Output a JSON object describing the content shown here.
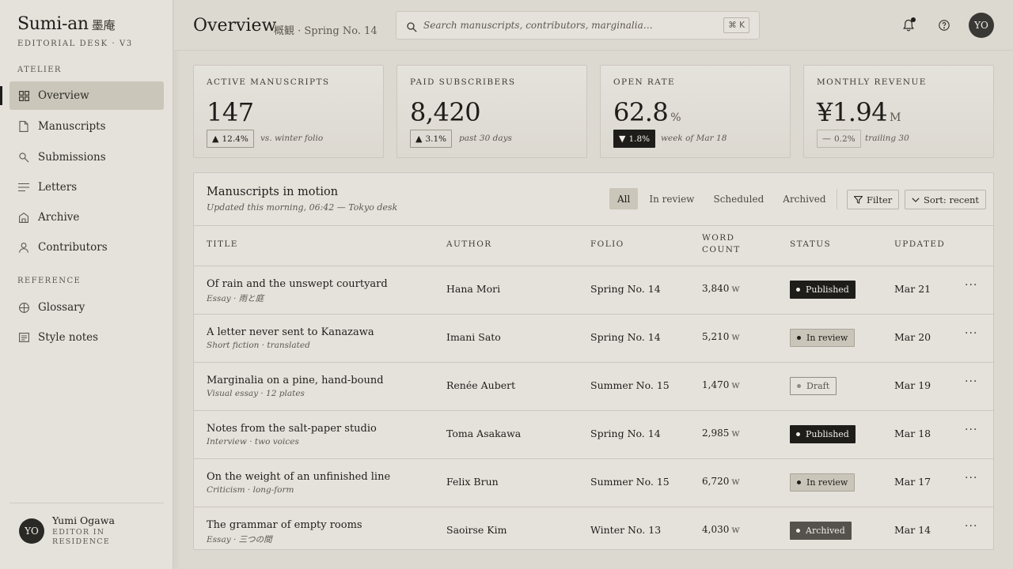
{
  "brand": {
    "name": "Sumi-an",
    "kanji": "墨庵",
    "subtitle": "EDITORIAL DESK · V3"
  },
  "sidebar": {
    "section_atelier": "ATELIER",
    "section_reference": "REFERENCE",
    "items": [
      {
        "label": "Overview",
        "icon": "grid-icon",
        "active": true
      },
      {
        "label": "Manuscripts",
        "icon": "document-icon"
      },
      {
        "label": "Submissions",
        "icon": "magnifier-icon"
      },
      {
        "label": "Letters",
        "icon": "lines-icon"
      },
      {
        "label": "Archive",
        "icon": "archive-icon"
      },
      {
        "label": "Contributors",
        "icon": "person-icon"
      }
    ],
    "reference_items": [
      {
        "label": "Glossary",
        "icon": "globe-icon"
      },
      {
        "label": "Style notes",
        "icon": "notes-icon"
      }
    ],
    "user": {
      "initials": "YO",
      "name": "Yumi Ogawa",
      "role_line1": "EDITOR IN",
      "role_line2": "RESIDENCE"
    }
  },
  "header": {
    "title": "Overview",
    "subtitle": "概観 · Spring No. 14",
    "search_placeholder": "Search manuscripts, contributors, marginalia…",
    "shortcut": "⌘ K",
    "avatar_initials": "YO"
  },
  "stats": [
    {
      "label": "ACTIVE MANUSCRIPTS",
      "value": "147",
      "unit": "",
      "delta": "12.4%",
      "direction": "up",
      "note": "vs. winter folio"
    },
    {
      "label": "PAID SUBSCRIBERS",
      "value": "8,420",
      "unit": "",
      "delta": "3.1%",
      "direction": "up",
      "note": "past 30 days"
    },
    {
      "label": "OPEN RATE",
      "value": "62.8",
      "unit": "%",
      "delta": "1.8%",
      "direction": "down",
      "note": "week of Mar 18"
    },
    {
      "label": "MONTHLY REVENUE",
      "value": "¥1.94",
      "unit": "M",
      "delta": "0.2%",
      "direction": "flat",
      "note": "trailing 30"
    }
  ],
  "panel": {
    "title": "Manuscripts in motion",
    "subtitle": "Updated this morning, 06:42 — Tokyo desk",
    "tabs": [
      "All",
      "In review",
      "Scheduled",
      "Archived"
    ],
    "filter_label": "Filter",
    "sort_label": "Sort: recent",
    "columns": {
      "title": "TITLE",
      "author": "AUTHOR",
      "folio": "FOLIO",
      "words_1": "WORD",
      "words_2": "COUNT",
      "status": "STATUS",
      "updated": "UPDATED"
    },
    "rows": [
      {
        "title": "Of rain and the unswept courtyard",
        "sub": "Essay · 雨と庭",
        "author": "Hana Mori",
        "folio": "Spring No. 14",
        "words": "3,840",
        "unit": "w",
        "status": "Published",
        "updated": "Mar 21"
      },
      {
        "title": "A letter never sent to Kanazawa",
        "sub": "Short fiction · translated",
        "author": "Imani Sato",
        "folio": "Spring No. 14",
        "words": "5,210",
        "unit": "w",
        "status": "In review",
        "updated": "Mar 20"
      },
      {
        "title": "Marginalia on a pine, hand-bound",
        "sub": "Visual essay · 12 plates",
        "author": "Renée Aubert",
        "folio": "Summer No. 15",
        "words": "1,470",
        "unit": "w",
        "status": "Draft",
        "updated": "Mar 19"
      },
      {
        "title": "Notes from the salt-paper studio",
        "sub": "Interview · two voices",
        "author": "Toma Asakawa",
        "folio": "Spring No. 14",
        "words": "2,985",
        "unit": "w",
        "status": "Published",
        "updated": "Mar 18"
      },
      {
        "title": "On the weight of an unfinished line",
        "sub": "Criticism · long-form",
        "author": "Felix Brun",
        "folio": "Summer No. 15",
        "words": "6,720",
        "unit": "w",
        "status": "In review",
        "updated": "Mar 17"
      },
      {
        "title": "The grammar of empty rooms",
        "sub": "Essay · 三つの間",
        "author": "Saoirse Kim",
        "folio": "Winter No. 13",
        "words": "4,030",
        "unit": "w",
        "status": "Archived",
        "updated": "Mar 14"
      }
    ]
  }
}
